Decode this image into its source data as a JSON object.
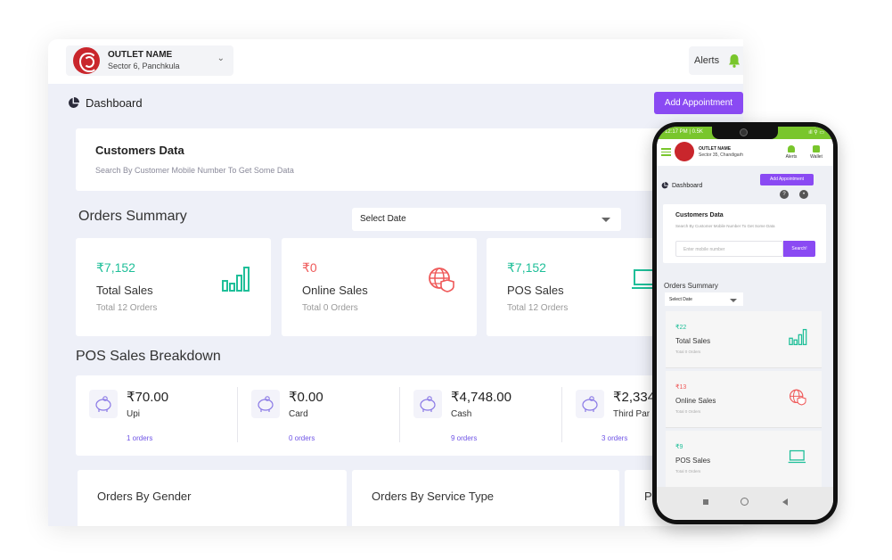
{
  "desktop": {
    "outlet": {
      "name": "OUTLET NAME",
      "location": "Sector 6, Panchkula"
    },
    "alerts_label": "Alerts",
    "dashboard_label": "Dashboard",
    "add_appointment_label": "Add Appointment",
    "customers": {
      "title": "Customers Data",
      "subtitle": "Search By Customer Mobile Number To Get Some Data"
    },
    "orders_summary_title": "Orders Summary",
    "select_date_label": "Select Date",
    "summary_cards": [
      {
        "amount": "₹7,152",
        "label": "Total Sales",
        "orders": "Total 12 Orders",
        "color": "#1fbf99",
        "icon": "bar-chart-icon"
      },
      {
        "amount": "₹0",
        "label": "Online Sales",
        "orders": "Total 0 Orders",
        "color": "#ef5a5a",
        "icon": "globe-shield-icon"
      },
      {
        "amount": "₹7,152",
        "label": "POS Sales",
        "orders": "Total 12 Orders",
        "color": "#1fbf99",
        "icon": "laptop-icon"
      }
    ],
    "pos_breakdown_title": "POS Sales Breakdown",
    "pos_items": [
      {
        "amount": "₹70.00",
        "label": "Upi",
        "orders": "1 orders"
      },
      {
        "amount": "₹0.00",
        "label": "Card",
        "orders": "0 orders"
      },
      {
        "amount": "₹4,748.00",
        "label": "Cash",
        "orders": "9 orders"
      },
      {
        "amount": "₹2,334",
        "label": "Third Par",
        "orders": "3 orders"
      }
    ],
    "bottom_cards": [
      "Orders By Gender",
      "Orders By Service Type",
      "P"
    ]
  },
  "phone": {
    "status_left": "12:17 PM | 0.5K",
    "status_right": "ıll ⚲ ▭",
    "outlet": {
      "name": "OUTLET NAME",
      "location": "Sector 35, Chandigarh"
    },
    "alerts_label": "Alerts",
    "wallet_label": "Wallet",
    "add_appointment_label": "Add Appointment",
    "dashboard_label": "Dashboard",
    "customers": {
      "title": "Customers Data",
      "subtitle": "Search By Customer Mobile Number To Get Some Data"
    },
    "mobile_placeholder": "Enter mobile number",
    "search_label": "Search!",
    "orders_summary_title": "Orders Summary",
    "select_date_label": "Select Date",
    "cards": [
      {
        "amount": "₹22",
        "label": "Total Sales",
        "orders": "Total 0 Orders",
        "color": "#1fbf99"
      },
      {
        "amount": "₹13",
        "label": "Online Sales",
        "orders": "Total 0 Orders",
        "color": "#ef5a5a"
      },
      {
        "amount": "₹9",
        "label": "POS Sales",
        "orders": "Total 0 Orders",
        "color": "#1fbf99"
      }
    ]
  },
  "colors": {
    "accent": "#8a4af3",
    "green": "#79c62c",
    "teal": "#1fbf99",
    "red": "#ef5a5a"
  }
}
